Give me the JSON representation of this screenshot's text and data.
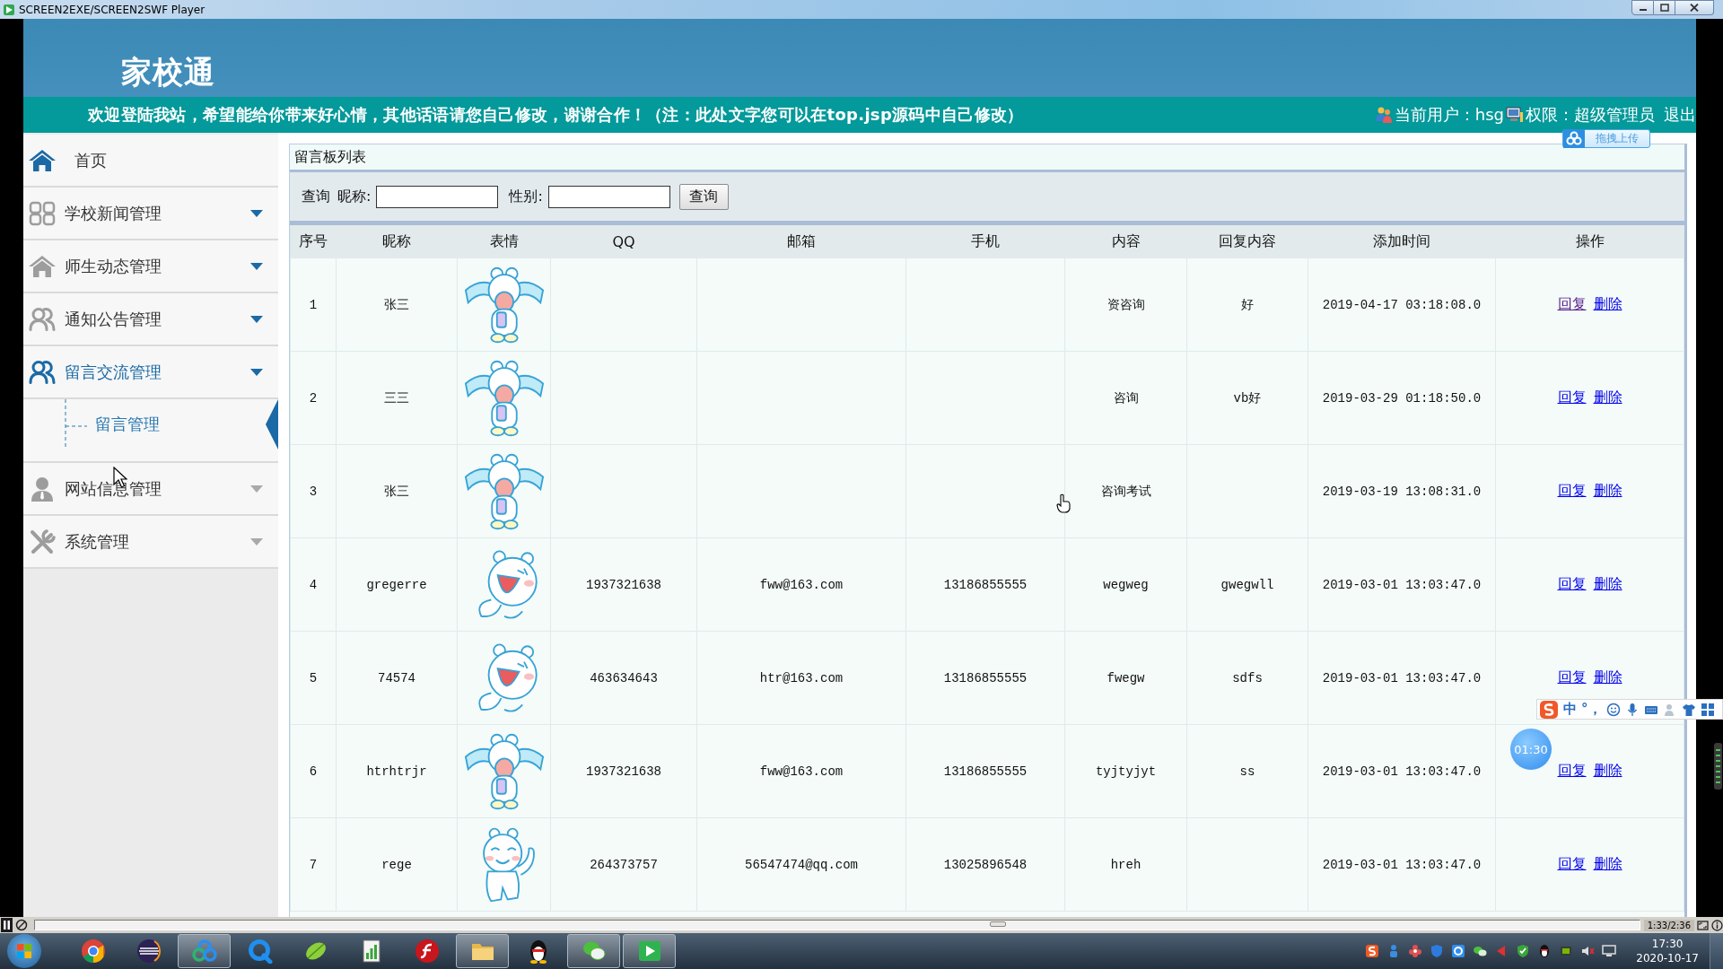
{
  "window": {
    "title": "SCREEN2EXE/SCREEN2SWF Player"
  },
  "header": {
    "logo": "家校通",
    "notice": "欢迎登陆我站，希望能给你带来好心情，其他话语请您自己修改，谢谢合作！（注：此处文字您可以在top.jsp源码中自己修改）",
    "user": "当前用户：hsg",
    "role": "权限：超级管理员",
    "logout": "退出"
  },
  "upload_button": {
    "label": "拖拽上传"
  },
  "sidebar": {
    "items": [
      {
        "label": "首页",
        "kind": "link"
      },
      {
        "label": "学校新闻管理",
        "kind": "menu",
        "expanded": false,
        "dimmed": false
      },
      {
        "label": "师生动态管理",
        "kind": "menu",
        "expanded": false,
        "dimmed": false
      },
      {
        "label": "通知公告管理",
        "kind": "menu",
        "expanded": false,
        "dimmed": false
      },
      {
        "label": "留言交流管理",
        "kind": "menu",
        "expanded": true,
        "dimmed": false,
        "children": [
          {
            "label": "留言管理",
            "selected": true
          }
        ]
      },
      {
        "label": "网站信息管理",
        "kind": "menu",
        "expanded": false,
        "dimmed": true
      },
      {
        "label": "系统管理",
        "kind": "menu",
        "expanded": false,
        "dimmed": true
      }
    ]
  },
  "panel": {
    "title": "留言板列表",
    "query": {
      "label": "查询",
      "nickname_label": "昵称:",
      "gender_label": "性别:",
      "button": "查询"
    }
  },
  "table": {
    "columns": [
      "序号",
      "昵称",
      "表情",
      "QQ",
      "邮箱",
      "手机",
      "内容",
      "回复内容",
      "添加时间",
      "操作"
    ],
    "rows": [
      {
        "no": "1",
        "nickname": "张三",
        "emoticon": {
          "kind": "crying"
        },
        "content": "资咨询",
        "reply": "好",
        "added": "2019-04-17 03:18:08.0",
        "actions": [
          {
            "label": "回复",
            "visited": true
          },
          {
            "label": "删除",
            "visited": false
          }
        ]
      },
      {
        "no": "2",
        "nickname": "三三",
        "emoticon": {
          "kind": "crying"
        },
        "content": "咨询",
        "reply": "vb好",
        "added": "2019-03-29 01:18:50.0",
        "actions": [
          {
            "label": "回复",
            "visited": false
          },
          {
            "label": "删除",
            "visited": false
          }
        ]
      },
      {
        "no": "3",
        "nickname": "张三",
        "emoticon": {
          "kind": "crying"
        },
        "content": "咨询考试",
        "added": "2019-03-19 13:08:31.0",
        "actions": [
          {
            "label": "回复",
            "visited": false
          },
          {
            "label": "删除",
            "visited": false
          }
        ]
      },
      {
        "no": "4",
        "nickname": "gregerre",
        "emoticon": {
          "kind": "laughing"
        },
        "qq": "1937321638",
        "email": "fww@163.com",
        "phone": "13186855555",
        "content": "wegweg",
        "reply": "gwegwll",
        "added": "2019-03-01 13:03:47.0",
        "actions": [
          {
            "label": "回复",
            "visited": false
          },
          {
            "label": "删除",
            "visited": false
          }
        ]
      },
      {
        "no": "5",
        "nickname": "74574",
        "emoticon": {
          "kind": "laughing"
        },
        "qq": "463634643",
        "email": "htr@163.com",
        "phone": "13186855555",
        "content": "fwegw",
        "reply": "sdfs",
        "added": "2019-03-01 13:03:47.0",
        "actions": [
          {
            "label": "回复",
            "visited": false
          },
          {
            "label": "删除",
            "visited": false
          }
        ]
      },
      {
        "no": "6",
        "nickname": "htrhtrjr",
        "emoticon": {
          "kind": "crying"
        },
        "qq": "1937321638",
        "email": "fww@163.com",
        "phone": "13186855555",
        "content": "tyjtyjyt",
        "reply": "ss",
        "added": "2019-03-01 13:03:47.0",
        "actions": [
          {
            "label": "回复",
            "visited": false
          },
          {
            "label": "删除",
            "visited": false
          }
        ]
      },
      {
        "no": "7",
        "nickname": "rege",
        "emoticon": {
          "kind": "waving"
        },
        "qq": "264373757",
        "email": "56547474@qq.com",
        "phone": "13025896548",
        "content": "hreh",
        "added": "2019-03-01 13:03:47.0",
        "actions": [
          {
            "label": "回复",
            "visited": false
          },
          {
            "label": "删除",
            "visited": false
          }
        ]
      }
    ]
  },
  "ime_toolbar": {
    "mode": "中",
    "punctuation": "°，"
  },
  "timer": "01:30",
  "player": {
    "level": 0.6,
    "time": "1:33/2:36"
  },
  "taskbar": {
    "apps": [
      {
        "running": false
      },
      {
        "running": false
      },
      {
        "running": true
      },
      {
        "running": false
      },
      {
        "running": false
      },
      {
        "running": false
      },
      {
        "running": false
      },
      {
        "running": true
      },
      {
        "running": false
      },
      {
        "running": true
      },
      {
        "running": true
      }
    ],
    "clock": {
      "time": "17:30",
      "date": "2020-10-17"
    }
  }
}
